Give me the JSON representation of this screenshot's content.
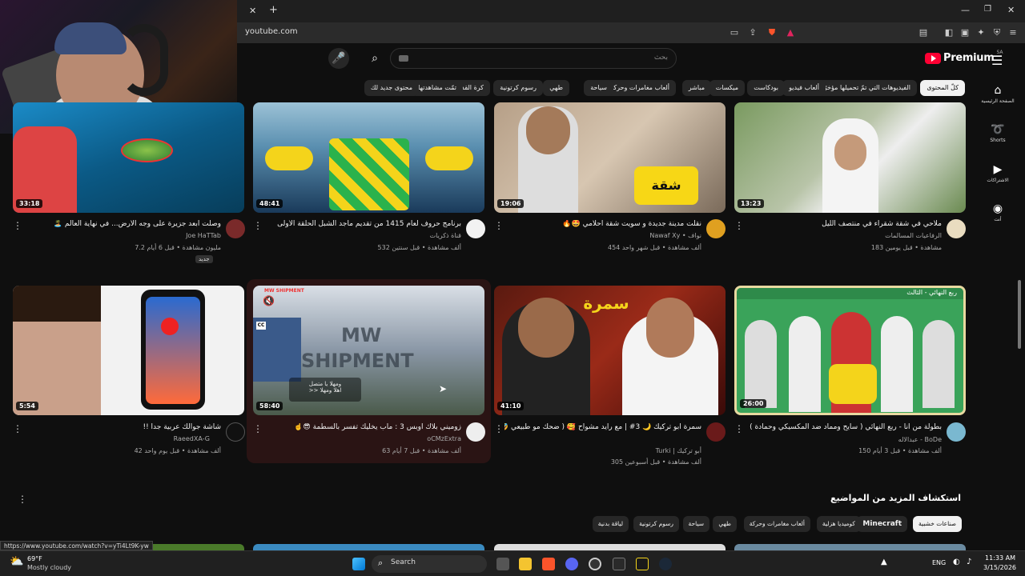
{
  "browser": {
    "url": "youtube.com",
    "status_url": "https://www.youtube.com/watch?v=yTi4Lt9K-yw"
  },
  "header": {
    "logo_text": "Premium",
    "region": "SA",
    "search_placeholder": "بحث"
  },
  "chips": [
    {
      "label": "كلّ المحتوى",
      "active": true
    },
    {
      "label": "الفيديوهات التي تمّ تحميلها مؤخرًا"
    },
    {
      "label": "ألعاب فيديو"
    },
    {
      "label": "بودكاست"
    },
    {
      "label": "ميكسات"
    },
    {
      "label": "مباشر"
    },
    {
      "label": "ألعاب مغامرات وحركة"
    },
    {
      "label": "سياحة"
    },
    {
      "label": "طهي"
    },
    {
      "label": "رسوم كرتونية"
    },
    {
      "label": "كرة القدم"
    },
    {
      "label": "تمّت مشاهدتها"
    },
    {
      "label": "محتوى جديد لك"
    }
  ],
  "sidebar": [
    {
      "label": "الصفحة الرئيسية",
      "icon": "home-icon"
    },
    {
      "label": "Shorts",
      "icon": "shorts-icon"
    },
    {
      "label": "الاشتراكات",
      "icon": "subscriptions-icon"
    },
    {
      "label": "أنت",
      "icon": "you-icon"
    }
  ],
  "videos_row1": [
    {
      "title": "ملاحي في شقة شقراء في منتصف الليل",
      "channel": "الرفاعيات المسالمات",
      "meta": "183 مشاهدة • قبل يومين",
      "duration": "13:23"
    },
    {
      "title": "نقلت مدينة جديدة و سويت شقة احلامي 🤩🔥",
      "channel": "Nawaf Xy • نواف",
      "meta": "454 ألف مشاهدة • قبل شهر واحد",
      "duration": "19:06"
    },
    {
      "title": "برنامج حروف لعام 1415 من تقديم ماجد الشبل الحلقة الأولى",
      "channel": "قناة ذكريات",
      "meta": "532 ألف مشاهدة • قبل سنتين",
      "duration": "48:41"
    },
    {
      "title": "وصلت أبعد جزيرة على وجه الأرض... في نهاية العالم 🏝️",
      "channel": "Joe HaTTab",
      "meta": "7.2 مليون مشاهدة • قبل 6 أيام",
      "badge": "جديد",
      "duration": "33:18"
    }
  ],
  "videos_row2": [
    {
      "title": "بطولة من أنا - ربع النهائي ( سايح ومماد ضد المكسيكي وحمادة )",
      "channel": "عبدالاله - BoDe",
      "meta": "150 ألف مشاهدة • قبل 3 أيام",
      "duration": "26:00",
      "thumb_text": "ربع النهائي - الثالث"
    },
    {
      "title": "سمرة أبو تركيك 🌙 3# | مع رايد مشواح 🥰 ( ضحك مو طبيعي 🤣 ) !! 🔥",
      "channel": "Turki | أبو تركيك",
      "meta": "305 ألف مشاهدة • قبل أسبوعين",
      "duration": "41:10"
    },
    {
      "title": "زوميني بلاك أوبس 3 : ماب يخليك تفسر بالسطمة 😎☝️",
      "channel": "oCMzExtra",
      "meta": "63 ألف مشاهدة • قبل 7 أيام",
      "duration": "58:40",
      "thumb_text": "MW SHIPMENT"
    },
    {
      "title": "شاشة جوالك عربية جدا !!",
      "channel": "RaeedXA-G",
      "meta": "42 ألف مشاهدة • قبل يوم واحد",
      "duration": "5:54"
    }
  ],
  "section": {
    "title": "استكشاف المزيد من المواضيع",
    "chips": [
      {
        "label": "صناعات خشبية",
        "active": true
      },
      {
        "label": "Minecraft",
        "bold": true
      },
      {
        "label": "كوميديا هزلية"
      },
      {
        "label": "ألعاب مغامرات وحركة"
      },
      {
        "label": "طهي"
      },
      {
        "label": "سياحة"
      },
      {
        "label": "رسوم كرتونية"
      },
      {
        "label": "لياقة بدنية"
      }
    ]
  },
  "taskbar": {
    "weather_temp": "69°F",
    "weather_desc": "Mostly cloudy",
    "search_label": "Search",
    "lang": "ENG",
    "time": "11:33 AM",
    "date": "3/15/2026"
  }
}
